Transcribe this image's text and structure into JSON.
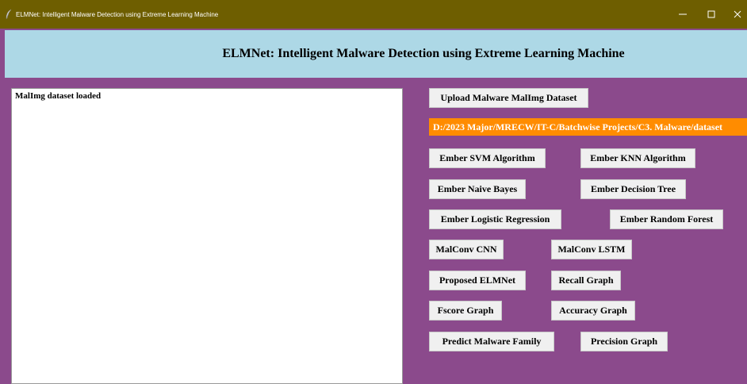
{
  "window": {
    "title": "ELMNet: Intelligent Malware Detection using Extreme Learning Machine"
  },
  "header": {
    "heading": "ELMNet: Intelligent Malware Detection using Extreme Learning Machine"
  },
  "output": {
    "text": "MalImg dataset loaded"
  },
  "upload": {
    "label": "Upload Malware MalImg Dataset"
  },
  "path_label": {
    "text": "D:/2023 Major/MRECW/IT-C/Batchwise Projects/C3. Malware/dataset"
  },
  "buttons": {
    "ember_svm": "Ember SVM Algorithm",
    "ember_knn": "Ember KNN Algorithm",
    "ember_nb": "Ember Naive Bayes",
    "ember_dt": "Ember Decision Tree",
    "ember_lr": "Ember Logistic Regression",
    "ember_rf": "Ember Random Forest",
    "malconv_cnn": "MalConv CNN",
    "malconv_lstm": "MalConv LSTM",
    "proposed_elmnet": "Proposed ELMNet",
    "recall_graph": "Recall Graph",
    "fscore_graph": "Fscore Graph",
    "accuracy_graph": "Accuracy Graph",
    "predict_family": "Predict Malware Family",
    "precision_graph": "Precision Graph"
  },
  "colors": {
    "titlebar": "#6e5e00",
    "background": "#8b4a8c",
    "header": "#add8e6",
    "path_label": "#ff8c00"
  },
  "icons": {
    "app": "feather-icon",
    "minimize": "minimize-icon",
    "maximize": "maximize-icon",
    "close": "close-icon"
  }
}
